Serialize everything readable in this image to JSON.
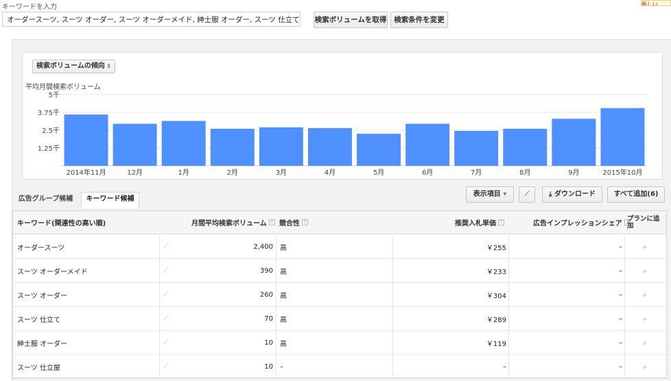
{
  "top": {
    "keyword_label": "キーワードを入力",
    "keyword_value": "オーダースーツ, スーツ オーダー, スーツ オーダーメイド, 紳士服 オーダー, スーツ 仕立て, スーツ",
    "get_volume_label": "検索ボリュームを取得",
    "change_criteria_label": "検索条件を変更",
    "corner_badge": "新しい"
  },
  "chart": {
    "dropdown_label": "検索ボリュームの傾向",
    "dropdown_arrow": "⇕",
    "ylabel": "平均月間検索ボリューム",
    "bar_color": "#4d90fe"
  },
  "chart_data": {
    "type": "bar",
    "categories": [
      "2014年11月",
      "12月",
      "1月",
      "2月",
      "3月",
      "4月",
      "5月",
      "6月",
      "7月",
      "8月",
      "9月",
      "2015年10月"
    ],
    "values": [
      3600,
      2950,
      3150,
      2600,
      2700,
      2650,
      2250,
      2950,
      2450,
      2600,
      3300,
      4050
    ],
    "ylim": [
      0,
      5000
    ],
    "yticks": [
      1250,
      2500,
      3750,
      5000
    ],
    "ytick_labels": [
      "1.25千",
      "2.5千",
      "3.75千",
      "5千"
    ],
    "grid": true
  },
  "tabs": {
    "adgroup": "広告グループ候補",
    "keyword": "キーワード候補"
  },
  "toolbar": {
    "columns_label": "表示項目",
    "columns_arrow": "▾",
    "chart_icon": "⟋",
    "download_label": "ダウンロード",
    "download_icon": "⤓",
    "add_all_label": "すべて追加(6)"
  },
  "table": {
    "headers": {
      "keyword": "キーワード(関連性の高い順)",
      "volume": "月間平均検索ボリューム",
      "competition": "競合性",
      "cpc": "推奨入札単価",
      "impression_share": "広告インプレッションシェア",
      "add_to_plan": "プランに追加",
      "help": "?"
    },
    "trend_icon": "⟋",
    "chevron": "»",
    "rows": [
      {
        "keyword": "オーダースーツ",
        "volume": "2,400",
        "competition": "高",
        "cpc": "￥255",
        "share": "–"
      },
      {
        "keyword": "スーツ オーダーメイド",
        "volume": "390",
        "competition": "高",
        "cpc": "￥233",
        "share": "–"
      },
      {
        "keyword": "スーツ オーダー",
        "volume": "260",
        "competition": "高",
        "cpc": "￥304",
        "share": "–"
      },
      {
        "keyword": "スーツ 仕立て",
        "volume": "70",
        "competition": "高",
        "cpc": "￥289",
        "share": "–"
      },
      {
        "keyword": "紳士服 オーダー",
        "volume": "10",
        "competition": "高",
        "cpc": "￥119",
        "share": "–"
      },
      {
        "keyword": "スーツ 仕立屋",
        "volume": "10",
        "competition": "–",
        "cpc": "–",
        "share": "–"
      }
    ]
  }
}
